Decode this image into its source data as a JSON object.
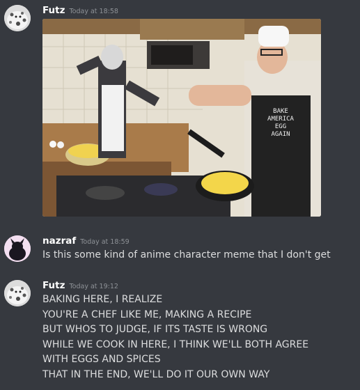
{
  "messages": [
    {
      "author": "Futz",
      "timestamp": "Today at 18:58",
      "avatar": "seal-avatar",
      "attachment": {
        "apron_text": [
          "BAKE",
          "AMERICA",
          "EGG",
          "AGAIN"
        ]
      }
    },
    {
      "author": "nazraf",
      "timestamp": "Today at 18:59",
      "avatar": "dark-creature-avatar",
      "text": "Is this some kind of anime character meme that I don't get"
    },
    {
      "author": "Futz",
      "timestamp": "Today at 19:12",
      "avatar": "seal-avatar",
      "lines": [
        "BAKING HERE, I REALIZE",
        "YOU'RE A CHEF LIKE ME, MAKING A RECIPE",
        "BUT WHOS TO JUDGE, IF ITS TASTE IS WRONG",
        "WHILE WE COOK IN HERE, I THINK WE'LL BOTH AGREE",
        "WITH EGGS AND SPICES",
        "THAT IN THE END, WE'LL DO IT OUR OWN WAY"
      ]
    }
  ],
  "colors": {
    "background": "#36393f",
    "author": "#ffffff",
    "timestamp": "#8e9297",
    "text": "#dcddde"
  }
}
